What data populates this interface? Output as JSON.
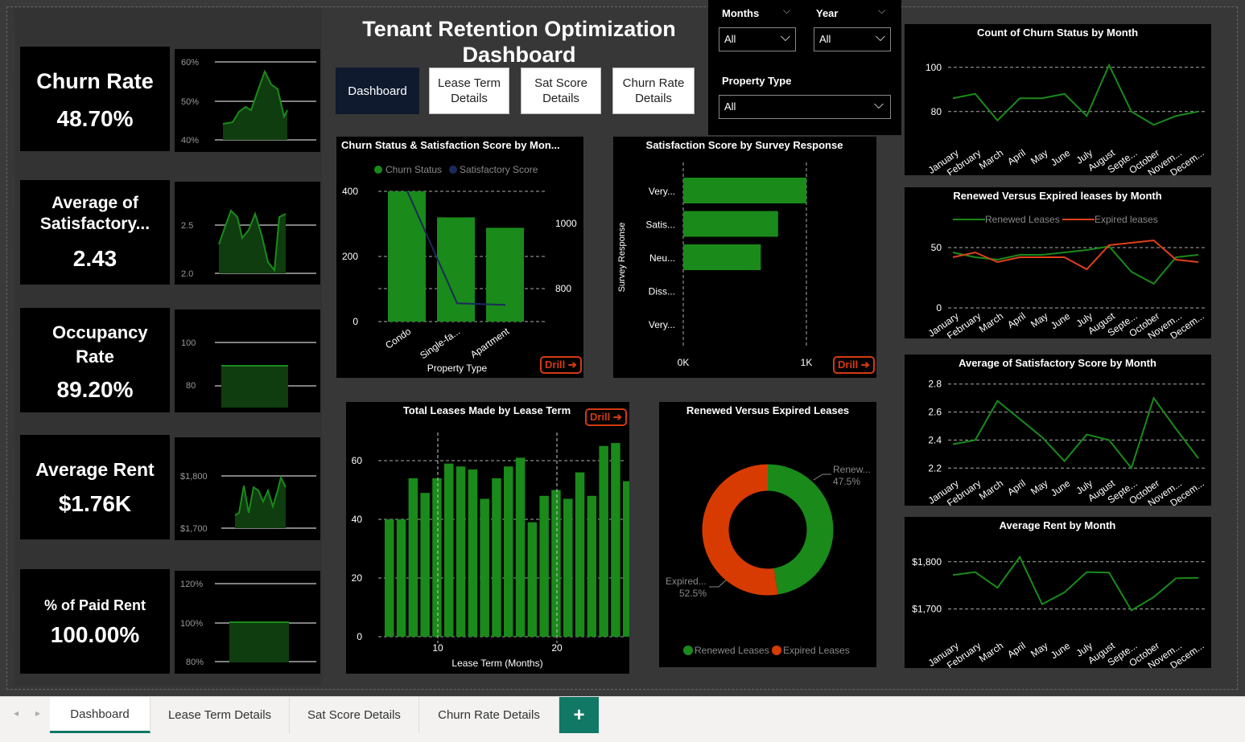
{
  "title": "Tenant Retention Optimization Dashboard",
  "nav": [
    "Dashboard",
    "Lease Term\nDetails",
    "Sat Score\nDetails",
    "Churn Rate\nDetails"
  ],
  "filters": {
    "months_label": "Months",
    "months_value": "All",
    "year_label": "Year",
    "year_value": "All",
    "property_label": "Property Type",
    "property_value": "All"
  },
  "kpis": [
    {
      "label": "Churn Rate",
      "value": "48.70%"
    },
    {
      "label": "Average of Satisfactory...",
      "value": "2.43"
    },
    {
      "label": "Occupancy Rate",
      "value": "89.20%"
    },
    {
      "label": "Average Rent",
      "value": "$1.76K"
    },
    {
      "label": "% of Paid Rent",
      "value": "100.00%"
    }
  ],
  "spark_ticks": [
    [
      "60%",
      "50%",
      "40%"
    ],
    [
      "2.5",
      "2.0"
    ],
    [
      "100",
      "80"
    ],
    [
      "$1,800",
      "$1,700"
    ],
    [
      "120%",
      "100%",
      "80%"
    ]
  ],
  "drill_label": "Drill",
  "months_short": [
    "January",
    "February",
    "March",
    "April",
    "May",
    "June",
    "July",
    "August",
    "Septe...",
    "October",
    "Novem...",
    "Decem..."
  ],
  "chart_data": [
    {
      "type": "bar",
      "title": "Churn Status & Satisfaction Score by Mon...",
      "categories": [
        "Condo",
        "Single-fa...",
        "Apartment"
      ],
      "series": [
        {
          "name": "Churn Status",
          "values": [
            400,
            320,
            288
          ],
          "color": "#1a8a1a"
        },
        {
          "name": "Satisfactory Score",
          "values": [
            1100,
            755,
            750
          ],
          "color": "#1b2a5c"
        }
      ],
      "xlabel": "Property Type",
      "y_ticks": [
        "400",
        "200",
        "0"
      ],
      "y2_ticks": [
        "1000",
        "800"
      ]
    },
    {
      "type": "bar",
      "title": "Satisfaction Score by Survey Response",
      "categories": [
        "Very...",
        "Satis...",
        "Neu...",
        "Diss...",
        "Very..."
      ],
      "values": [
        1000,
        770,
        630,
        0,
        0
      ],
      "ylabel": "Survey Response",
      "x_ticks": [
        "0K",
        "1K"
      ]
    },
    {
      "type": "line",
      "title": "Count of Churn Status by Month",
      "categories": [
        "January",
        "February",
        "March",
        "April",
        "May",
        "June",
        "July",
        "August",
        "Septe...",
        "October",
        "Novem...",
        "Decem..."
      ],
      "values": [
        86,
        88,
        76,
        86,
        86,
        88,
        78,
        101,
        80,
        74,
        78,
        80
      ],
      "y_ticks": [
        "100",
        "80"
      ]
    },
    {
      "type": "line",
      "title": "Renewed Versus Expired leases by Month",
      "categories": [
        "January",
        "February",
        "March",
        "April",
        "May",
        "June",
        "July",
        "August",
        "Septe...",
        "October",
        "Novem...",
        "Decem..."
      ],
      "series": [
        {
          "name": "Renewed Leases",
          "values": [
            46,
            42,
            40,
            44,
            44,
            46,
            48,
            51,
            30,
            20,
            42,
            44
          ],
          "color": "#1a8a1a"
        },
        {
          "name": "Expired leases",
          "values": [
            42,
            46,
            38,
            42,
            42,
            42,
            32,
            52,
            54,
            56,
            40,
            38
          ],
          "color": "#e0401a"
        }
      ],
      "y_ticks": [
        "50",
        "0"
      ]
    },
    {
      "type": "line",
      "title": "Average of Satisfactory Score by Month",
      "categories": [
        "January",
        "February",
        "March",
        "April",
        "May",
        "June",
        "July",
        "August",
        "Septe...",
        "October",
        "Novem...",
        "Decem..."
      ],
      "values": [
        2.37,
        2.4,
        2.68,
        2.55,
        2.42,
        2.25,
        2.44,
        2.4,
        2.2,
        2.7,
        2.48,
        2.27
      ],
      "y_ticks": [
        "2.8",
        "2.6",
        "2.4",
        "2.2"
      ]
    },
    {
      "type": "line",
      "title": "Average Rent by Month",
      "categories": [
        "January",
        "February",
        "March",
        "April",
        "May",
        "June",
        "July",
        "August",
        "Septe...",
        "October",
        "Novem...",
        "Decem..."
      ],
      "values": [
        1772,
        1778,
        1745,
        1810,
        1710,
        1735,
        1778,
        1777,
        1697,
        1725,
        1765,
        1766
      ],
      "y_ticks": [
        "$1,800",
        "$1,700"
      ]
    },
    {
      "type": "bar",
      "title": "Total Leases Made by Lease Term",
      "x": [
        6,
        7,
        8,
        9,
        10,
        11,
        12,
        13,
        14,
        15,
        16,
        17,
        18,
        19,
        20,
        21,
        22,
        23,
        24
      ],
      "values": [
        40,
        40,
        54,
        49,
        54,
        59,
        58,
        57,
        47,
        54,
        58,
        61,
        39,
        48,
        50,
        47,
        56,
        48,
        65
      ],
      "extra_values": [
        66,
        53
      ],
      "xlabel": "Lease Term (Months)",
      "y_ticks": [
        "60",
        "40",
        "20",
        "0"
      ],
      "x_ticks": [
        "10",
        "20"
      ]
    },
    {
      "type": "pie",
      "title": "Renewed Versus Expired Leases",
      "series": [
        {
          "name": "Renewed Leases",
          "value": 47.5,
          "color": "#1a8a1a"
        },
        {
          "name": "Expired Leases",
          "value": 52.5,
          "color": "#d83b01"
        }
      ],
      "labels": [
        {
          "name": "Renew...",
          "value": "47.5%"
        },
        {
          "name": "Expired...",
          "value": "52.5%"
        }
      ]
    }
  ],
  "tabs": [
    "Dashboard",
    "Lease Term Details",
    "Sat Score Details",
    "Churn Rate Details"
  ],
  "tab_add": "+"
}
